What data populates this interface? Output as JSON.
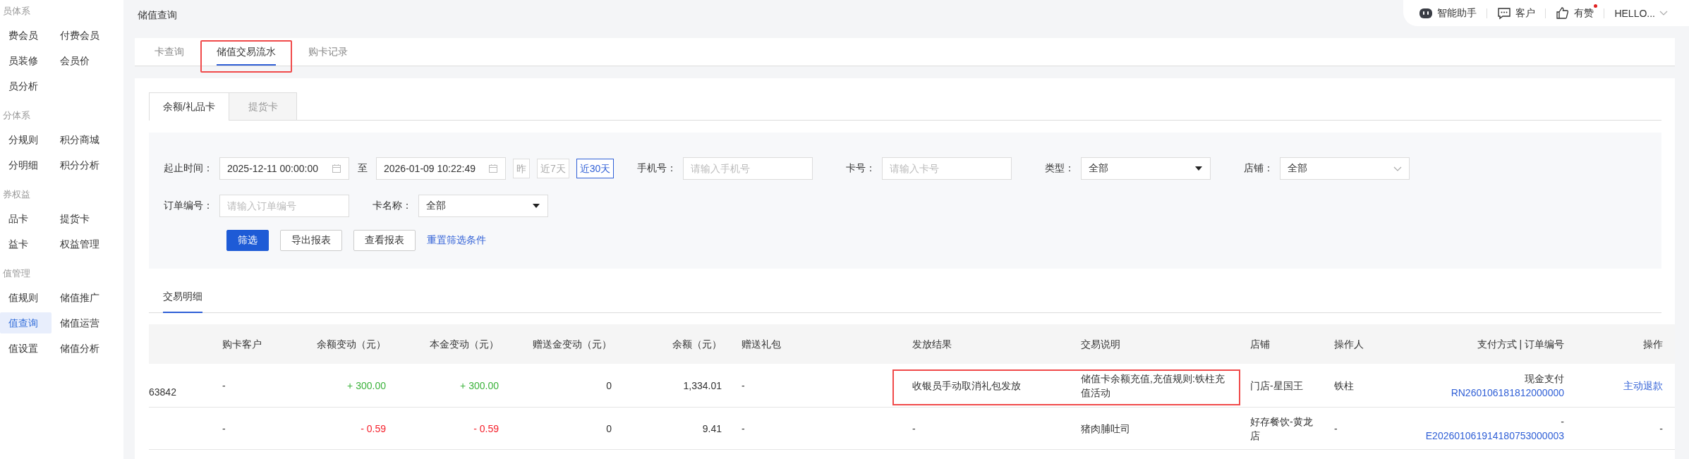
{
  "sidebar": {
    "groups": [
      {
        "title": "员体系",
        "items": [
          {
            "label": "费会员",
            "selected": false
          },
          {
            "label": "付费会员",
            "selected": false
          },
          {
            "label": "员装修",
            "selected": false
          },
          {
            "label": "会员价",
            "selected": false
          },
          {
            "label": "员分析",
            "selected": false
          }
        ]
      },
      {
        "title": "分体系",
        "items": [
          {
            "label": "分规则",
            "selected": false
          },
          {
            "label": "积分商城",
            "selected": false
          },
          {
            "label": "分明细",
            "selected": false
          },
          {
            "label": "积分分析",
            "selected": false
          }
        ]
      },
      {
        "title": "券权益",
        "items": [
          {
            "label": "品卡",
            "selected": false
          },
          {
            "label": "提货卡",
            "selected": false
          },
          {
            "label": "益卡",
            "selected": false
          },
          {
            "label": "权益管理",
            "selected": false
          }
        ]
      },
      {
        "title": "值管理",
        "items": [
          {
            "label": "值规则",
            "selected": false
          },
          {
            "label": "储值推广",
            "selected": false
          },
          {
            "label": "值查询",
            "selected": true
          },
          {
            "label": "储值运营",
            "selected": false
          },
          {
            "label": "值设置",
            "selected": false
          },
          {
            "label": "储值分析",
            "selected": false
          }
        ]
      }
    ]
  },
  "page_title": "储值查询",
  "top_bar": [
    {
      "kind": "assistant",
      "label": "智能助手",
      "badge": false
    },
    {
      "kind": "customer",
      "label": "客户",
      "badge": false
    },
    {
      "kind": "likes",
      "label": "有赞",
      "badge": true
    },
    {
      "kind": "account",
      "label": "HELLO...",
      "badge": false
    }
  ],
  "tabs": [
    {
      "label": "卡查询",
      "selected": false,
      "highlighted": false
    },
    {
      "label": "储值交易流水",
      "selected": true,
      "highlighted": true
    },
    {
      "label": "购卡记录",
      "selected": false,
      "highlighted": false
    }
  ],
  "card_tabs": [
    {
      "label": "余额/礼品卡",
      "selected": true
    },
    {
      "label": "提货卡",
      "selected": false
    }
  ],
  "filters": [
    [
      {
        "kind": "date_range",
        "label": "起止时间：",
        "start": "2025-12-11 00:00:00",
        "separator": "至",
        "end": "2026-01-09 10:22:49",
        "presets": [
          {
            "label": "昨",
            "selected": false
          },
          {
            "label": "近7天",
            "selected": false
          },
          {
            "label": "近30天",
            "selected": true
          }
        ]
      },
      {
        "kind": "input",
        "label": "手机号：",
        "placeholder": "请输入手机号"
      },
      {
        "kind": "input",
        "label": "卡号：",
        "placeholder": "请输入卡号"
      },
      {
        "kind": "select",
        "label": "类型：",
        "value": "全部"
      },
      {
        "kind": "picker",
        "label": "店铺：",
        "value": "全部"
      }
    ],
    [
      {
        "kind": "input",
        "label": "订单编号：",
        "placeholder": "请输入订单编号"
      },
      {
        "kind": "select",
        "label": "卡名称：",
        "value": "全部"
      }
    ]
  ],
  "actions": [
    {
      "kind": "primary",
      "label": "筛选"
    },
    {
      "kind": "default",
      "label": "导出报表"
    },
    {
      "kind": "default",
      "label": "查看报表"
    },
    {
      "kind": "link",
      "label": "重置筛选条件"
    }
  ],
  "detail_tab": {
    "label": "交易明细",
    "selected": true
  },
  "table": {
    "columns": [
      "购卡客户",
      "余额变动（元）",
      "本金变动（元）",
      "赠送金变动（元）",
      "余额（元）",
      "赠送礼包",
      "发放结果",
      "交易说明",
      "店铺",
      "操作人",
      "支付方式 | 订单编号",
      "操作"
    ],
    "rows": [
      {
        "highlighted": true,
        "column_1": "63842",
        "customer": "-",
        "balance_change": {
          "text": "+ 300.00",
          "color": "#3db33d"
        },
        "principal_change": {
          "text": "+ 300.00",
          "color": "#3db33d"
        },
        "bonus_change": "0",
        "balance": "1,334.01",
        "gift_pack": "-",
        "issue_result": "收银员手动取消礼包发放",
        "description": "储值卡余额充值,充值规则:铁柱充值活动",
        "store": "门店-星国王",
        "operator": "铁柱",
        "payment_method": "现金支付",
        "order_no": "RN260106181812000000",
        "action": {
          "text": "主动退款",
          "kind": "link"
        }
      },
      {
        "highlighted": false,
        "customer": "-",
        "balance_change": {
          "text": "- 0.59",
          "color": "#f5222d"
        },
        "principal_change": {
          "text": "- 0.59",
          "color": "#f5222d"
        },
        "bonus_change": "0",
        "balance": "9.41",
        "gift_pack": "-",
        "issue_result": "-",
        "description": "猪肉脯吐司",
        "store": "好存餐饮-黄龙店",
        "operator": "-",
        "payment_method": "-",
        "order_no": "E202601061914180753000003",
        "action": {
          "text": "-",
          "kind": "text"
        }
      }
    ]
  }
}
